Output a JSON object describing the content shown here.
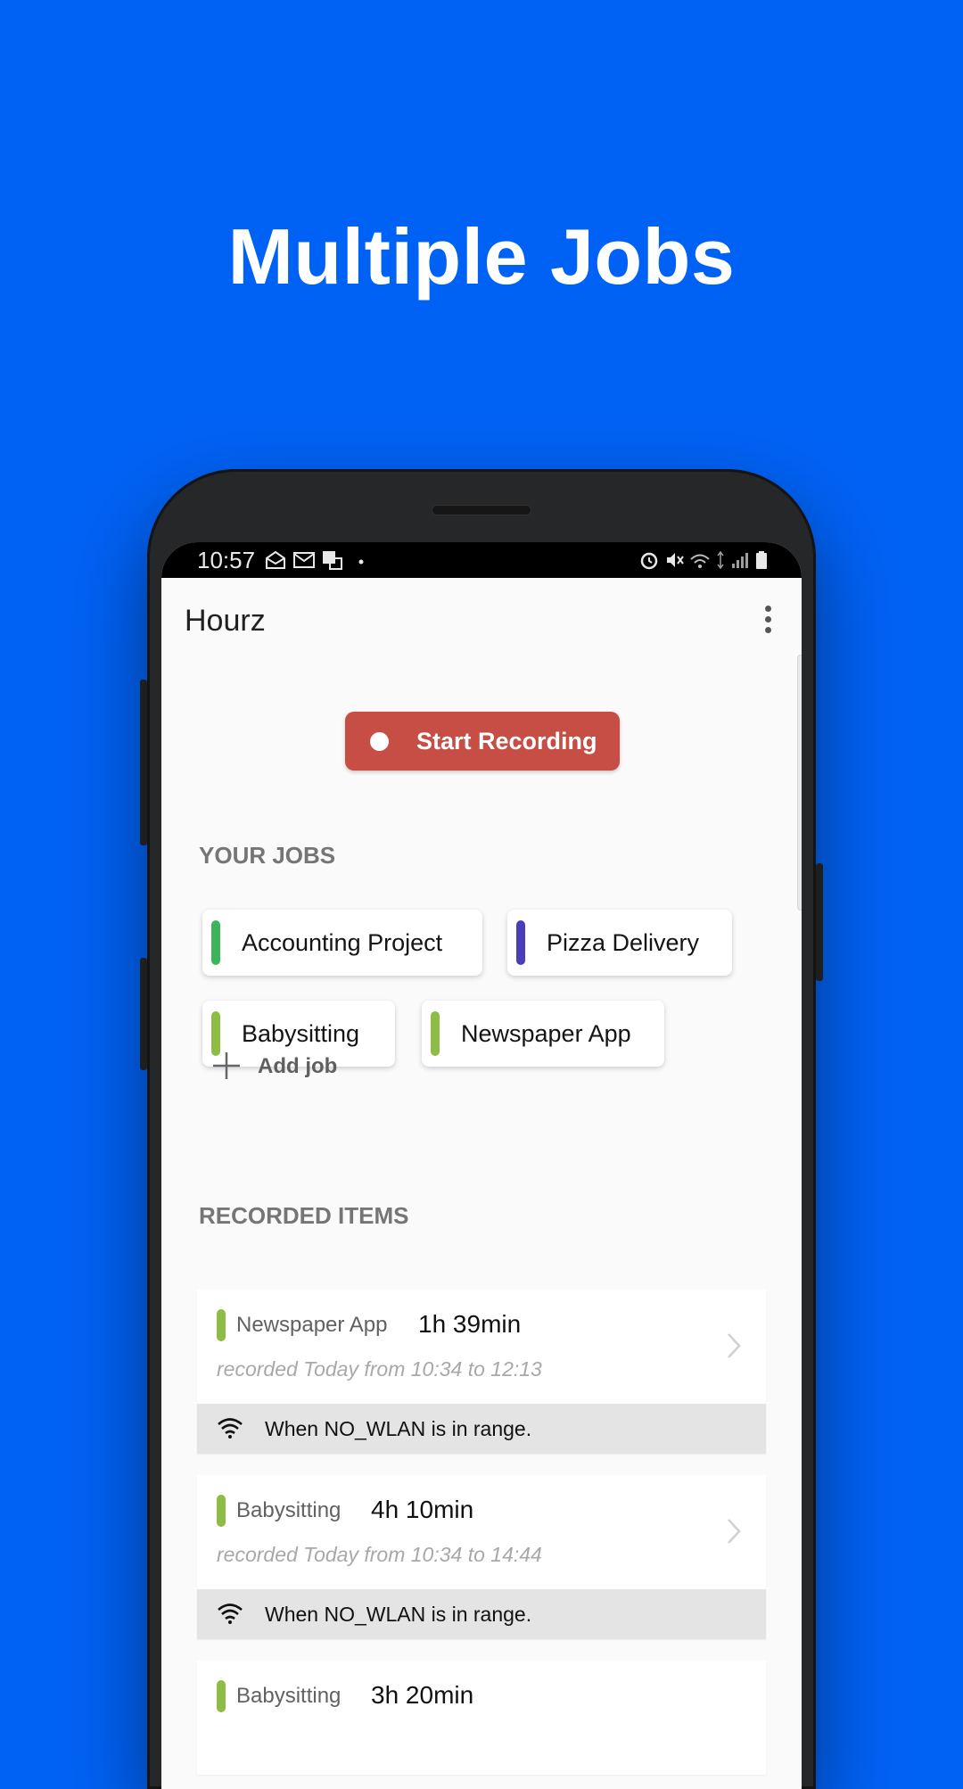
{
  "headline": "Multiple Jobs",
  "status_bar": {
    "time": "10:57"
  },
  "app": {
    "title": "Hourz",
    "record_button_label": "Start Recording",
    "jobs_section_title": "YOUR JOBS",
    "jobs": [
      {
        "label": "Accounting Project",
        "color": "#3CB55A"
      },
      {
        "label": "Pizza Delivery",
        "color": "#4A3DB8"
      },
      {
        "label": "Babysitting",
        "color": "#8DBD45"
      },
      {
        "label": "Newspaper App",
        "color": "#8DBD45"
      }
    ],
    "add_job_label": "Add job",
    "recorded_section_title": "RECORDED ITEMS",
    "recorded_items": [
      {
        "job": "Newspaper App",
        "duration": "1h 39min",
        "subtitle": "recorded Today from 10:34 to 12:13",
        "note": "When NO_WLAN is in range.",
        "color": "#8DBD45"
      },
      {
        "job": "Babysitting",
        "duration": "4h 10min",
        "subtitle": "recorded Today from 10:34 to 14:44",
        "note": "When NO_WLAN is in range.",
        "color": "#8DBD45"
      },
      {
        "job": "Babysitting",
        "duration": "3h 20min",
        "color": "#8DBD45"
      }
    ]
  },
  "colors": {
    "background": "#0062F5",
    "record_button": "#C64E44"
  }
}
